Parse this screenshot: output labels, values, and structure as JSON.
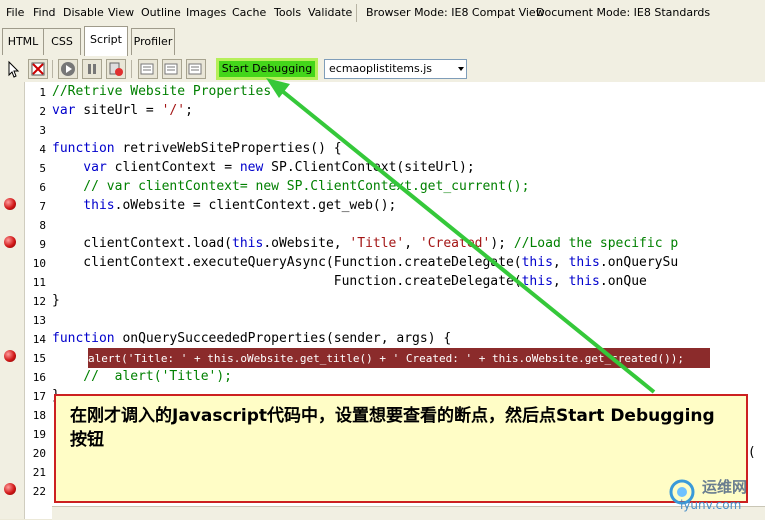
{
  "menu": [
    "File",
    "Find",
    "Disable",
    "View",
    "Outline",
    "Images",
    "Cache",
    "Tools",
    "Validate"
  ],
  "browser_mode": "Browser Mode: IE8 Compat View",
  "document_mode": "Document Mode: IE8 Standards",
  "tabs": [
    "HTML",
    "CSS",
    "Script",
    "Profiler"
  ],
  "active_tab": "Script",
  "toolbar": {
    "start_debugging": "Start Debugging",
    "file_select": "ecmaoplistitems.js"
  },
  "line_numbers": [
    "1",
    "2",
    "3",
    "4",
    "5",
    "6",
    "7",
    "8",
    "9",
    "10",
    "11",
    "12",
    "13",
    "14",
    "15",
    "16",
    "17",
    "18",
    "19",
    "20",
    "21",
    "22"
  ],
  "breakpoint_lines": [
    7,
    9,
    15,
    22
  ],
  "code": {
    "l1": "//Retrive Website Properties",
    "l2a": "var",
    "l2b": " siteUrl = ",
    "l2c": "'/'",
    "l2d": ";",
    "l4a": "function",
    "l4b": " retriveWebSiteProperties() {",
    "l5a": "    var",
    "l5b": " clientContext = ",
    "l5c": "new",
    "l5d": " SP.ClientContext(siteUrl);",
    "l6": "    // var clientContext= new SP.ClientContext.get_current();",
    "l7a": "    this",
    "l7b": ".oWebsite = clientContext.get_web();",
    "l9a": "    clientContext.load(",
    "l9b": "this",
    "l9c": ".oWebsite, ",
    "l9d": "'Title'",
    "l9e": ", ",
    "l9f": "'Created'",
    "l9g": "); ",
    "l9h": "//Load the specific p",
    "l10a": "    clientContext.executeQueryAsync(Function.createDelegate(",
    "l10b": "this",
    "l10c": ", ",
    "l10d": "this",
    "l10e": ".onQuerySu",
    "l11a": "                                    Function.createDelegate(",
    "l11b": "this",
    "l11c": ", ",
    "l11d": "this",
    "l11e": ".onQue",
    "l12": "}",
    "l14a": "function",
    "l14b": " onQuerySucceededProperties(sender, args) {",
    "l15": "alert('Title: ' + this.oWebsite.get_title() + ' Created: ' + this.oWebsite.get_created());",
    "l16": "    //  alert('Title');",
    "l17": "}",
    "l20": "e("
  },
  "callout_text": "在刚才调入的Javascript代码中，设置想要查看的断点，然后点Start Debugging按钮",
  "watermark": {
    "text": "运维网",
    "url": "iyunv.com"
  },
  "colors": {
    "start_button": "#43d61a",
    "arrow": "#35c83a",
    "highlight": "#8b2b2b",
    "breakpoint": "#d11818",
    "callout_border": "#cc2020",
    "callout_bg": "#fffdc6"
  }
}
